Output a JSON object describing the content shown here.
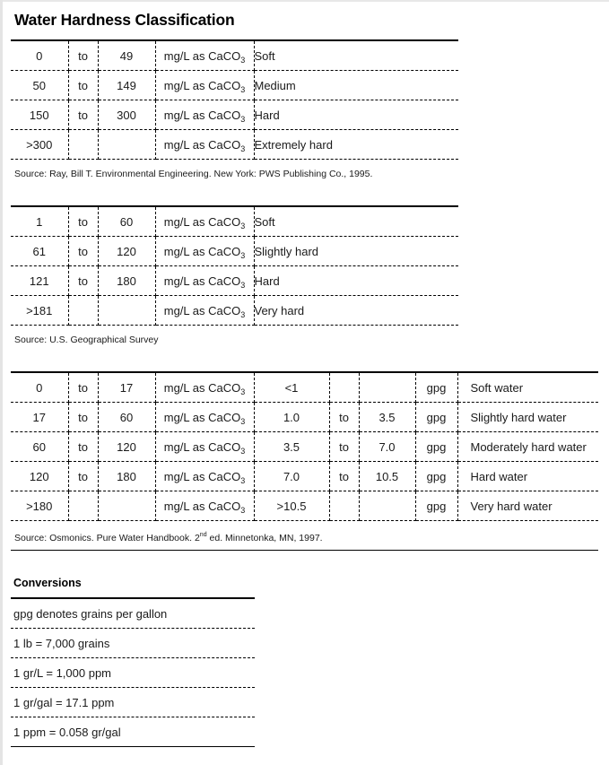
{
  "title": "Water Hardness Classification",
  "unit_prefix": "mg/L as CaCO",
  "unit_subscript": "3",
  "table1": {
    "rows": [
      {
        "from": "0",
        "to_word": "to",
        "to": "49",
        "class": "Soft"
      },
      {
        "from": "50",
        "to_word": "to",
        "to": "149",
        "class": "Medium"
      },
      {
        "from": "150",
        "to_word": "to",
        "to": "300",
        "class": "Hard"
      },
      {
        "from": ">300",
        "to_word": "",
        "to": "",
        "class": "Extremely hard"
      }
    ],
    "source": "Source: Ray, Bill T. Environmental Engineering. New York: PWS Publishing Co., 1995."
  },
  "table2": {
    "rows": [
      {
        "from": "1",
        "to_word": "to",
        "to": "60",
        "class": "Soft"
      },
      {
        "from": "61",
        "to_word": "to",
        "to": "120",
        "class": "Slightly hard"
      },
      {
        "from": "121",
        "to_word": "to",
        "to": "180",
        "class": "Hard"
      },
      {
        "from": ">181",
        "to_word": "",
        "to": "",
        "class": "Very hard"
      }
    ],
    "source": "Source: U.S. Geographical Survey"
  },
  "table3": {
    "gpg_unit": "gpg",
    "rows": [
      {
        "from": "0",
        "to_word": "to",
        "to": "17",
        "gpg_from": "<1",
        "gpg_to_word": "",
        "gpg_to": "",
        "class": "Soft water"
      },
      {
        "from": "17",
        "to_word": "to",
        "to": "60",
        "gpg_from": "1.0",
        "gpg_to_word": "to",
        "gpg_to": "3.5",
        "class": "Slightly hard water"
      },
      {
        "from": "60",
        "to_word": "to",
        "to": "120",
        "gpg_from": "3.5",
        "gpg_to_word": "to",
        "gpg_to": "7.0",
        "class": "Moderately hard water"
      },
      {
        "from": "120",
        "to_word": "to",
        "to": "180",
        "gpg_from": "7.0",
        "gpg_to_word": "to",
        "gpg_to": "10.5",
        "class": "Hard water"
      },
      {
        "from": ">180",
        "to_word": "",
        "to": "",
        "gpg_from": ">10.5",
        "gpg_to_word": "",
        "gpg_to": "",
        "class": "Very hard water"
      }
    ],
    "source_prefix": "Source: Osmonics. Pure Water Handbook. 2",
    "source_sup": "nd",
    "source_suffix": " ed. Minnetonka, MN, 1997."
  },
  "conversions": {
    "title": "Conversions",
    "items": [
      "gpg denotes grains per gallon",
      "1 lb = 7,000 grains",
      "1 gr/L = 1,000 ppm",
      "1 gr/gal = 17.1 ppm",
      "1 ppm = 0.058 gr/gal"
    ]
  }
}
